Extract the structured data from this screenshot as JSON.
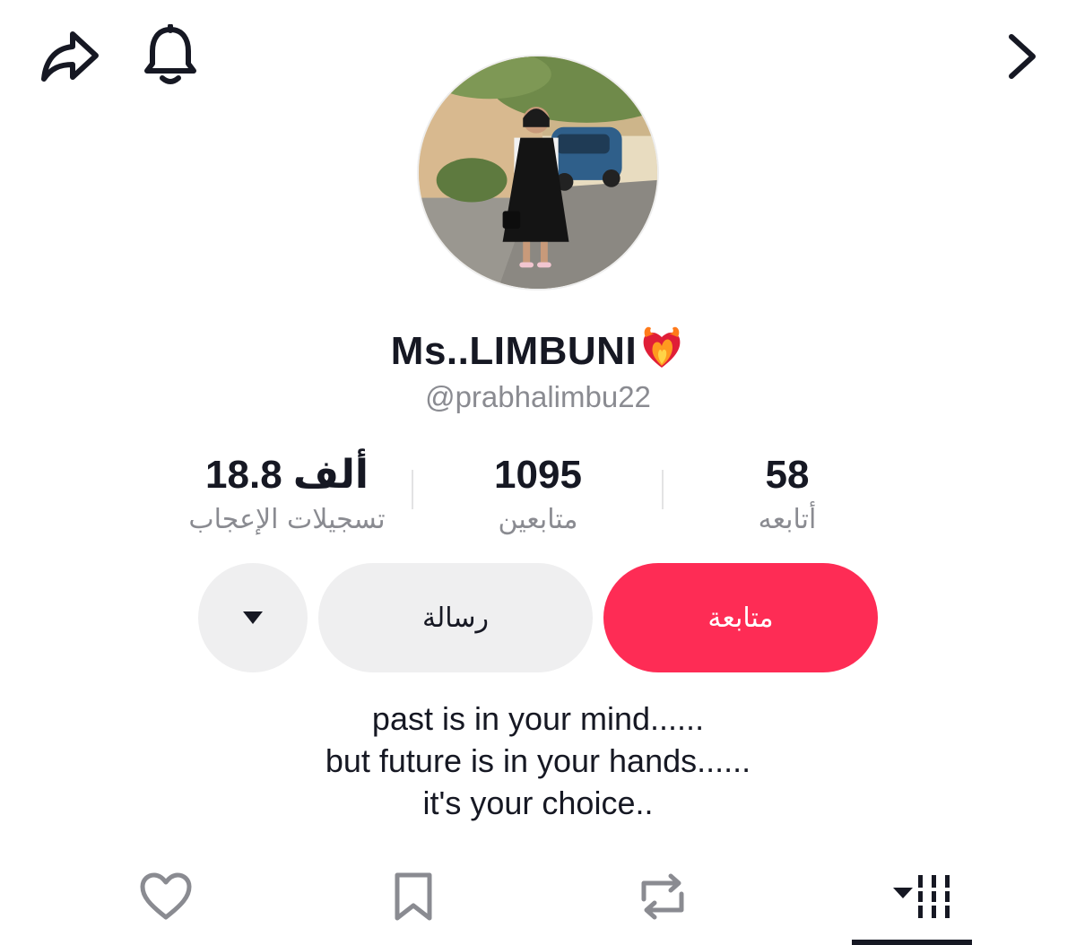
{
  "header": {
    "share_icon": "share-arrow-icon",
    "bell_icon": "bell-icon",
    "next_icon": "chevron-right-icon"
  },
  "profile": {
    "display_name": "Ms..LIMBUNI",
    "name_emoji": "heart-on-fire-emoji",
    "username": "@prabhalimbu22"
  },
  "stats": {
    "likes": {
      "value": "18.8 ألف",
      "label": "تسجيلات الإعجاب"
    },
    "followers": {
      "value": "1095",
      "label": "متابعين"
    },
    "following": {
      "value": "58",
      "label": "أتابعه"
    }
  },
  "actions": {
    "follow_label": "متابعة",
    "message_label": "رسالة",
    "dropdown_icon": "caret-down-icon"
  },
  "bio": {
    "lines": [
      "past is in your mind......",
      "but future is in your hands......",
      "it's your choice.."
    ]
  },
  "tabs": [
    {
      "icon": "heart-icon",
      "name": "liked"
    },
    {
      "icon": "bookmark-icon",
      "name": "saved"
    },
    {
      "icon": "repost-icon",
      "name": "reposts"
    },
    {
      "icon": "video-grid-icon",
      "name": "videos",
      "active": true
    }
  ],
  "colors": {
    "follow_button": "#fe2c55",
    "secondary_button": "#efeff0",
    "muted_text": "#8a8b91",
    "primary_text": "#161823"
  }
}
